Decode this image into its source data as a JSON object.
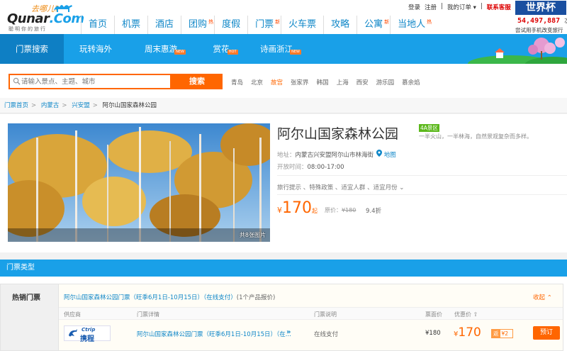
{
  "logo": {
    "tagline": "去哪儿?",
    "brand_a": "Qunar",
    "brand_b": ".Com",
    "slogan": "聪明你的旅行"
  },
  "main_nav": [
    {
      "label": "首页",
      "badge": ""
    },
    {
      "label": "机票",
      "badge": ""
    },
    {
      "label": "酒店",
      "badge": ""
    },
    {
      "label": "团购",
      "badge": "热"
    },
    {
      "label": "度假",
      "badge": ""
    },
    {
      "label": "门票",
      "badge": "新"
    },
    {
      "label": "火车票",
      "badge": ""
    },
    {
      "label": "攻略",
      "badge": ""
    },
    {
      "label": "公寓",
      "badge": "新"
    },
    {
      "label": "当地人",
      "badge": "热"
    }
  ],
  "top_links": {
    "login": "登录",
    "register": "注册",
    "my_orders": "我的订单 ▾",
    "service": "联系客服"
  },
  "worldcup": {
    "title": "世界杯",
    "count": "54,497,887",
    "count_unit": "次",
    "sub": "尝试用手机改变旅行"
  },
  "sub_nav": [
    {
      "label": "门票搜索",
      "badge": ""
    },
    {
      "label": "玩转海外",
      "badge": ""
    },
    {
      "label": "周末惠游",
      "badge": "NEW"
    },
    {
      "label": "赏花",
      "badge": "HOT"
    },
    {
      "label": "诗画浙江",
      "badge": "NEW"
    }
  ],
  "search": {
    "placeholder": "请输入景点、主题、城市",
    "button": "搜索"
  },
  "hot_cities": [
    {
      "name": "青岛",
      "highlight": false
    },
    {
      "name": "北京",
      "highlight": false
    },
    {
      "name": "故宫",
      "highlight": true
    },
    {
      "name": "张家界",
      "highlight": false
    },
    {
      "name": "韩国",
      "highlight": false
    },
    {
      "name": "上海",
      "highlight": false
    },
    {
      "name": "西安",
      "highlight": false
    },
    {
      "name": "游乐园",
      "highlight": false
    },
    {
      "name": "慕余焰",
      "highlight": false
    }
  ],
  "breadcrumb": [
    "门票首页",
    "内蒙古",
    "兴安盟",
    "阿尔山国家森林公园"
  ],
  "product": {
    "title": "阿尔山国家森林公园",
    "level": "4A景区",
    "slogan": "一半火山，一半林海，自然景观复杂而多样。",
    "address_label": "地址：",
    "address": "内蒙古兴安盟阿尔山市林海街",
    "map_link": "地图",
    "hours_label": "开放时间：",
    "hours": "08:00-17:00",
    "tips": "旅行提示 、特殊政策 、适宜人群 、适宜月份 ⌄",
    "price_currency": "¥",
    "price": "170",
    "price_unit": "起",
    "orig_label": "原价：",
    "orig_price": "¥180",
    "discount": "9.4折",
    "photo_caption": "共8张图片"
  },
  "tickets": {
    "section_title": "门票类型",
    "category": "热销门票",
    "group_title": "阿尔山国家森林公园门票（旺季6月1日-10月15日）（在线支付）",
    "group_count": "(1个产品报价)",
    "collapse": "收起 ⌃",
    "columns": {
      "supplier": "供应商",
      "detail": "门票详情",
      "desc": "门票说明",
      "face": "票面价",
      "price": "优惠价 ⇧"
    },
    "row": {
      "supplier_a": "Ctrip",
      "supplier_b": "携程",
      "name": "阿尔山国家森林公园门票（旺季6月1日-10月15日）（在...",
      "more": "»",
      "pay": "在线支付",
      "face_price": "¥180",
      "price_currency": "¥",
      "price": "170",
      "cashback_label": "返",
      "cashback": "¥2",
      "book": "预订"
    }
  },
  "colors": {
    "accent_blue": "#19a0e8",
    "accent_orange": "#ff6600",
    "level_green": "#5cb81c"
  }
}
